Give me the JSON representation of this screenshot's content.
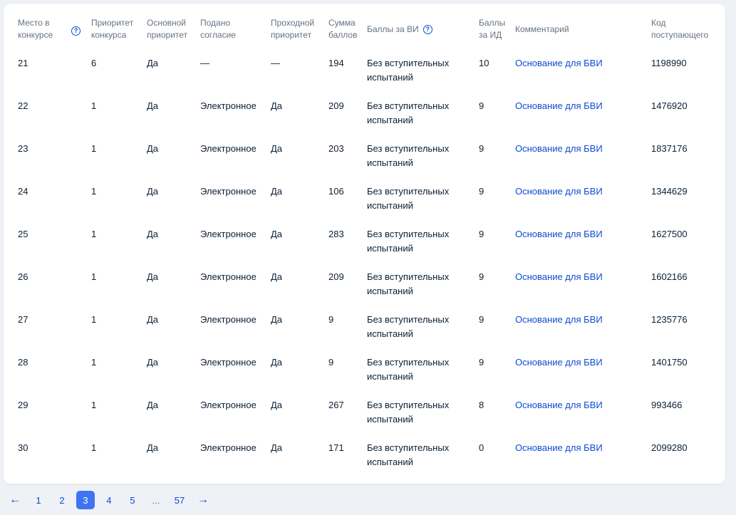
{
  "table": {
    "headers": {
      "place": [
        "Место в",
        "конкурсе"
      ],
      "priority": [
        "Приоритет",
        "конкурса"
      ],
      "main_priority": [
        "Основной",
        "приоритет"
      ],
      "consent": [
        "Подано",
        "согласие"
      ],
      "pass_priority": [
        "Проходной",
        "приоритет"
      ],
      "sum": [
        "Сумма",
        "баллов"
      ],
      "vi": "Баллы за ВИ",
      "id": [
        "Баллы",
        "за ИД"
      ],
      "comment": "Комментарий",
      "code": [
        "Код",
        "поступающего"
      ]
    },
    "help_glyph": "?",
    "vi_line1": "Без вступительных",
    "vi_line2": "испытаний",
    "rows": [
      {
        "place": "21",
        "priority": "6",
        "main": "Да",
        "consent": "—",
        "pass": "—",
        "sum": "194",
        "id": "10",
        "comment": "Основание для БВИ",
        "code": "1198990"
      },
      {
        "place": "22",
        "priority": "1",
        "main": "Да",
        "consent": "Электронное",
        "pass": "Да",
        "sum": "209",
        "id": "9",
        "comment": "Основание для БВИ",
        "code": "1476920"
      },
      {
        "place": "23",
        "priority": "1",
        "main": "Да",
        "consent": "Электронное",
        "pass": "Да",
        "sum": "203",
        "id": "9",
        "comment": "Основание для БВИ",
        "code": "1837176"
      },
      {
        "place": "24",
        "priority": "1",
        "main": "Да",
        "consent": "Электронное",
        "pass": "Да",
        "sum": "106",
        "id": "9",
        "comment": "Основание для БВИ",
        "code": "1344629"
      },
      {
        "place": "25",
        "priority": "1",
        "main": "Да",
        "consent": "Электронное",
        "pass": "Да",
        "sum": "283",
        "id": "9",
        "comment": "Основание для БВИ",
        "code": "1627500"
      },
      {
        "place": "26",
        "priority": "1",
        "main": "Да",
        "consent": "Электронное",
        "pass": "Да",
        "sum": "209",
        "id": "9",
        "comment": "Основание для БВИ",
        "code": "1602166"
      },
      {
        "place": "27",
        "priority": "1",
        "main": "Да",
        "consent": "Электронное",
        "pass": "Да",
        "sum": "9",
        "id": "9",
        "comment": "Основание для БВИ",
        "code": "1235776"
      },
      {
        "place": "28",
        "priority": "1",
        "main": "Да",
        "consent": "Электронное",
        "pass": "Да",
        "sum": "9",
        "id": "9",
        "comment": "Основание для БВИ",
        "code": "1401750"
      },
      {
        "place": "29",
        "priority": "1",
        "main": "Да",
        "consent": "Электронное",
        "pass": "Да",
        "sum": "267",
        "id": "8",
        "comment": "Основание для БВИ",
        "code": "993466"
      },
      {
        "place": "30",
        "priority": "1",
        "main": "Да",
        "consent": "Электронное",
        "pass": "Да",
        "sum": "171",
        "id": "0",
        "comment": "Основание для БВИ",
        "code": "2099280"
      }
    ]
  },
  "pagination": {
    "prev": "←",
    "next": "→",
    "pages": [
      "1",
      "2",
      "3",
      "4",
      "5",
      "...",
      "57"
    ],
    "active": "3"
  },
  "colors": {
    "accent": "#0d4cd3",
    "active_page": "#3f73f0"
  }
}
